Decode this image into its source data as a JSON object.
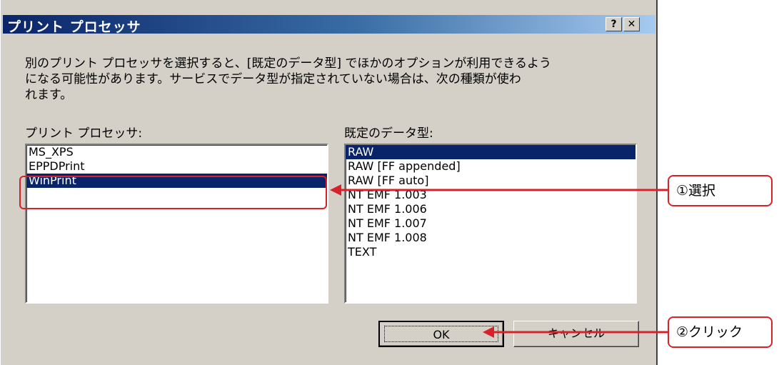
{
  "dialog": {
    "title": "プリント プロセッサ",
    "help_label": "?",
    "close_label": "✕",
    "description_lines": [
      "別のプリント プロセッサを選択すると、[既定のデータ型] でほかのオプションが利用できるよう",
      "になる可能性があります。サービスでデータ型が指定されていない場合は、次の種類が使わ",
      "れます。"
    ]
  },
  "processor_list": {
    "label": "プリント プロセッサ:",
    "items": [
      "MS_XPS",
      "EPPDPrint",
      "WinPrint"
    ],
    "selected": "WinPrint"
  },
  "datatype_list": {
    "label": "既定のデータ型:",
    "items": [
      "RAW",
      "RAW [FF appended]",
      "RAW [FF auto]",
      "NT EMF 1.003",
      "NT EMF 1.006",
      "NT EMF 1.007",
      "NT EMF 1.008",
      "TEXT"
    ],
    "selected": "RAW"
  },
  "buttons": {
    "ok": "OK",
    "cancel": "キャンセル"
  },
  "annotations": {
    "step1": "①選択",
    "step2": "②クリック",
    "color": "#d8222a"
  },
  "colors": {
    "selection": "#0a246a",
    "dialog_bg": "#d4d0c8"
  }
}
